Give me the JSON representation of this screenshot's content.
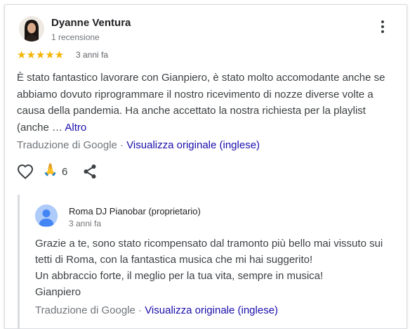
{
  "review": {
    "author": "Dyanne Ventura",
    "author_reviews": "1 recensione",
    "rating": 5,
    "stars": "★★★★★",
    "date": "3 anni fa",
    "text": "È stato fantastico lavorare con Gianpiero, è stato molto accomodante anche se abbiamo dovuto riprogrammare il nostro ricevimento di nozze diverse volte a causa della pandemia. Ha anche accettato la nostra richiesta per la playlist (anche … ",
    "more_label": "Altro",
    "translation_label": "Traduzione di Google · ",
    "original_link": "Visualizza originale (inglese)",
    "reaction_count": "6"
  },
  "icons": {
    "more": "more-vert-icon",
    "like": "heart-outline-icon",
    "reaction": "folded-hands-emoji",
    "share": "share-icon",
    "owner_avatar": "person-icon"
  },
  "reply": {
    "owner": "Roma DJ Pianobar (proprietario)",
    "date": "3 anni fa",
    "lines": [
      "Grazie a te, sono stato ricompensato dal tramonto più bello mai vissuto sui",
      "tetti di Roma, con la fantastica musica che mi hai suggerito!",
      "Un abbraccio forte, il meglio per la tua vita, sempre in musica!",
      "Gianpiero"
    ],
    "translation_label": "Traduzione di Google · ",
    "original_link": "Visualizza originale (inglese)"
  },
  "colors": {
    "star": "#f4b400",
    "link": "#1a0dab",
    "owner_avatar_bg": "#aecbfa"
  }
}
